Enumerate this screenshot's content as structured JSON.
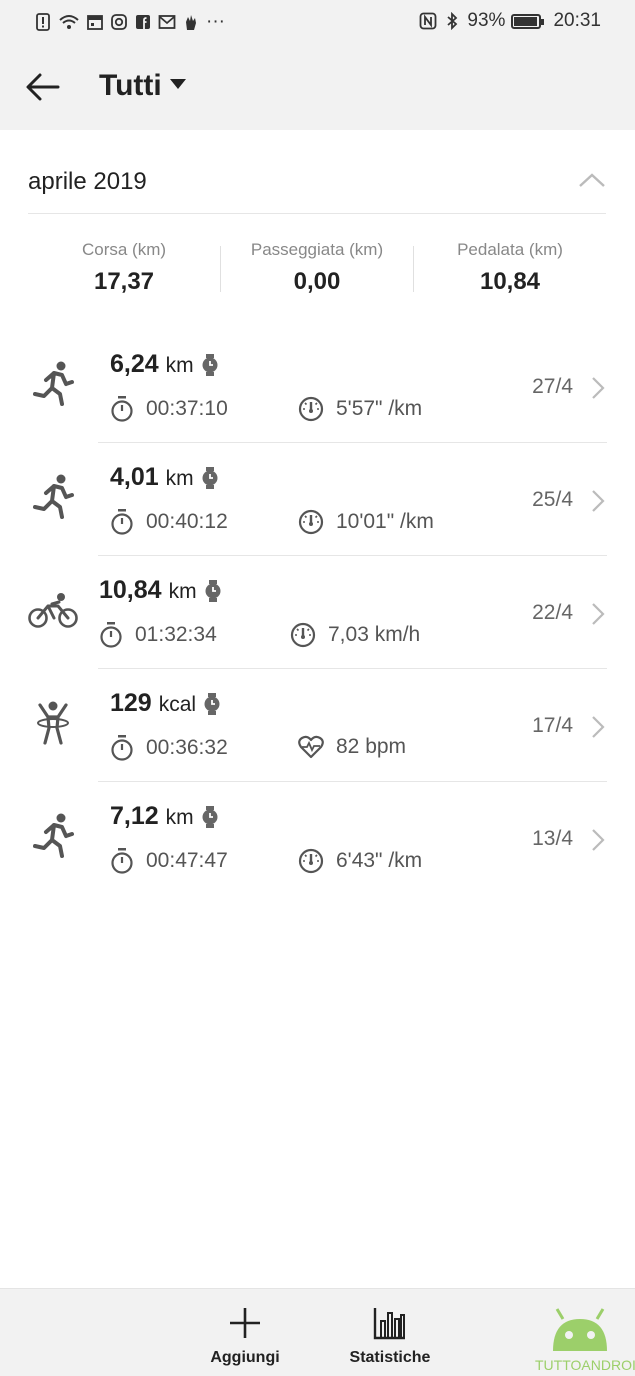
{
  "status_bar": {
    "battery": "93%",
    "time": "20:31",
    "more": "···"
  },
  "app_bar": {
    "title": "Tutti"
  },
  "month": {
    "title": "aprile 2019"
  },
  "summary": [
    {
      "label": "Corsa (km)",
      "value": "17,37"
    },
    {
      "label": "Passeggiata (km)",
      "value": "0,00"
    },
    {
      "label": "Pedalata (km)",
      "value": "10,84"
    }
  ],
  "activities": [
    {
      "type": "running-icon",
      "value": "6,24",
      "unit": "km",
      "duration": "00:37:10",
      "metric_icon": "pace-icon",
      "metric": "5'57\" /km",
      "date": "27/4"
    },
    {
      "type": "running-icon",
      "value": "4,01",
      "unit": "km",
      "duration": "00:40:12",
      "metric_icon": "pace-icon",
      "metric": "10'01\" /km",
      "date": "25/4"
    },
    {
      "type": "cycling-icon",
      "value": "10,84",
      "unit": "km",
      "duration": "01:32:34",
      "metric_icon": "speed-icon",
      "metric": "7,03 km/h",
      "date": "22/4"
    },
    {
      "type": "workout-icon",
      "value": "129",
      "unit": "kcal",
      "duration": "00:36:32",
      "metric_icon": "heart-rate-icon",
      "metric": "82 bpm",
      "date": "17/4"
    },
    {
      "type": "running-icon",
      "value": "7,12",
      "unit": "km",
      "duration": "00:47:47",
      "metric_icon": "pace-icon",
      "metric": "6'43\" /km",
      "date": "13/4"
    }
  ],
  "bottom_bar": {
    "add_label": "Aggiungi",
    "stats_label": "Statistiche"
  },
  "watermark": {
    "text": "TUTTOANDROID"
  },
  "colors": {
    "background": "#f2f2f2",
    "card": "#ffffff",
    "text_primary": "#222222",
    "text_secondary": "#888888",
    "icon_gray": "#555555",
    "watermark_green": "#9ccf6a"
  }
}
